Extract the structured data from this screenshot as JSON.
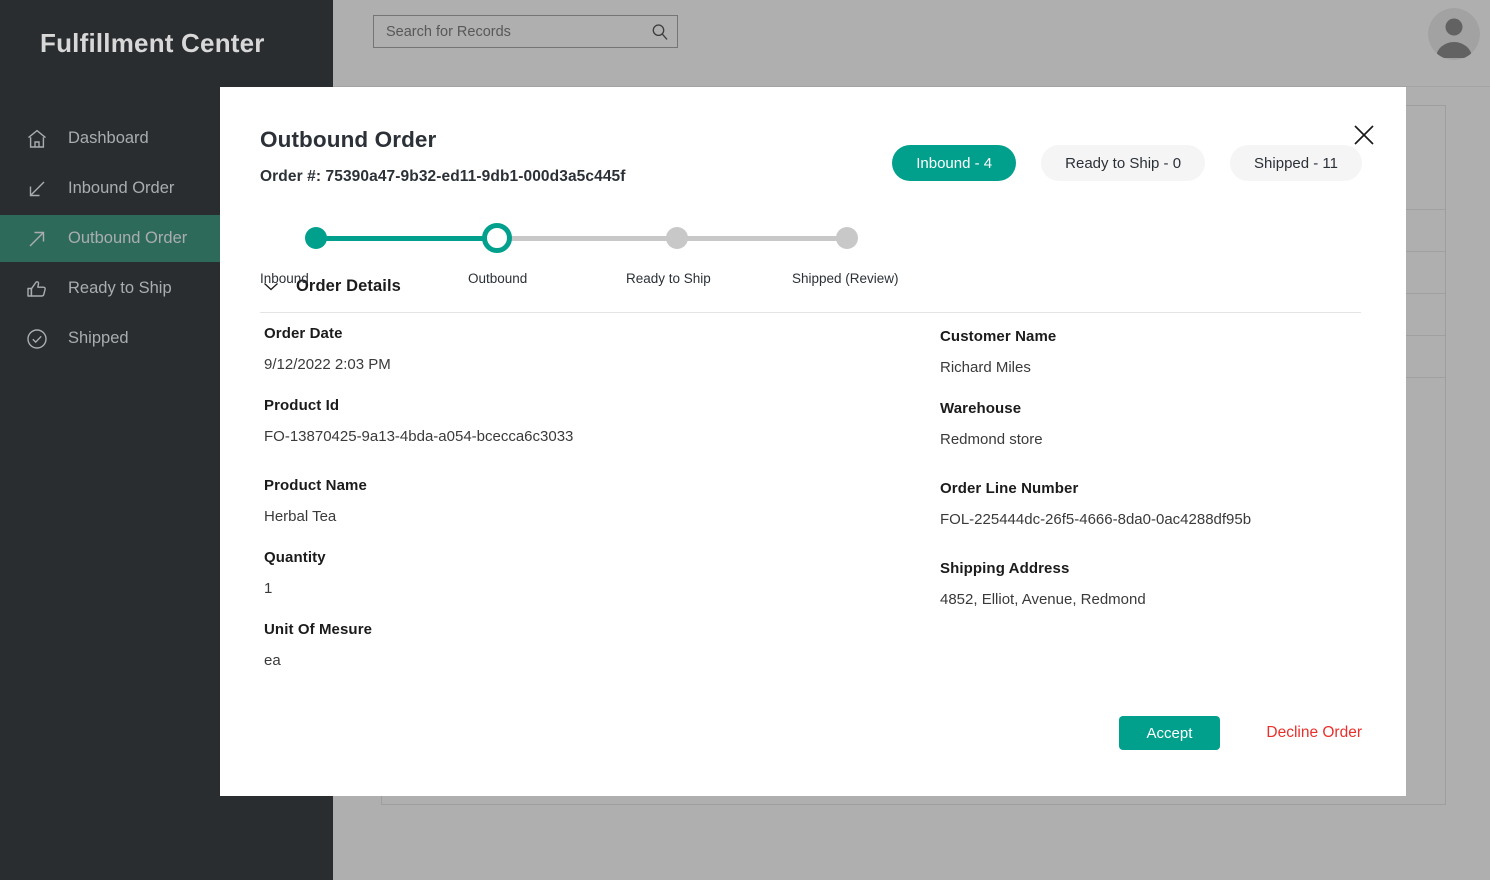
{
  "app": {
    "brand": "Fulfillment Center"
  },
  "sidebar": {
    "items": [
      {
        "label": "Dashboard",
        "icon": "home-icon",
        "active": false
      },
      {
        "label": "Inbound Order",
        "icon": "arrow-down-left-icon",
        "active": false
      },
      {
        "label": "Outbound Order",
        "icon": "arrow-up-right-icon",
        "active": true
      },
      {
        "label": "Ready to Ship",
        "icon": "thumbs-up-icon",
        "active": false
      },
      {
        "label": "Shipped",
        "icon": "check-circle-icon",
        "active": false
      }
    ]
  },
  "topbar": {
    "search": {
      "placeholder": "Search for Records",
      "value": "",
      "icon": "search-icon"
    },
    "avatar_icon": "user-avatar-icon"
  },
  "modal": {
    "title": "Outbound Order",
    "order_number": "Order #: 75390a47-9b32-ed11-9db1-000d3a5c445f",
    "close_icon": "close-icon",
    "pills": [
      {
        "label": "Inbound - 4",
        "active": true
      },
      {
        "label": "Ready to Ship - 0",
        "active": false
      },
      {
        "label": "Shipped - 11",
        "active": false
      }
    ],
    "stepper": {
      "steps": [
        {
          "label": "Inbound",
          "state": "done"
        },
        {
          "label": "Outbound",
          "state": "current"
        },
        {
          "label": "Ready to Ship",
          "state": "pending"
        },
        {
          "label": "Shipped (Review)",
          "state": "pending"
        }
      ]
    },
    "details_section": {
      "title": "Order Details",
      "chevron_icon": "chevron-down-icon",
      "expanded": true,
      "left_fields": [
        {
          "label": "Order Date",
          "value": " 9/12/2022 2:03 PM"
        },
        {
          "label": "Product Id",
          "value": "FO-13870425-9a13-4bda-a054-bcecca6c3033"
        },
        {
          "label": "Product Name",
          "value": "Herbal Tea"
        },
        {
          "label": "Quantity",
          "value": "1"
        },
        {
          "label": "Unit Of Mesure",
          "value": "ea"
        }
      ],
      "right_fields": [
        {
          "label": "Customer Name",
          "value": " Richard Miles"
        },
        {
          "label": "Warehouse",
          "value": "Redmond store"
        },
        {
          "label": "Order Line Number",
          "value": "FOL-225444dc-26f5-4666-8da0-0ac4288df95b"
        },
        {
          "label": "Shipping Address",
          "value": "4852, Elliot, Avenue, Redmond"
        }
      ]
    },
    "actions": {
      "accept_label": "Accept",
      "decline_label": "Decline Order"
    }
  },
  "colors": {
    "accent_teal": "#00a08c",
    "sidebar_bg": "#292d30",
    "sidebar_active": "#2e6a5a",
    "danger_red": "#e8312c",
    "step_pending": "#c8c8c8"
  }
}
